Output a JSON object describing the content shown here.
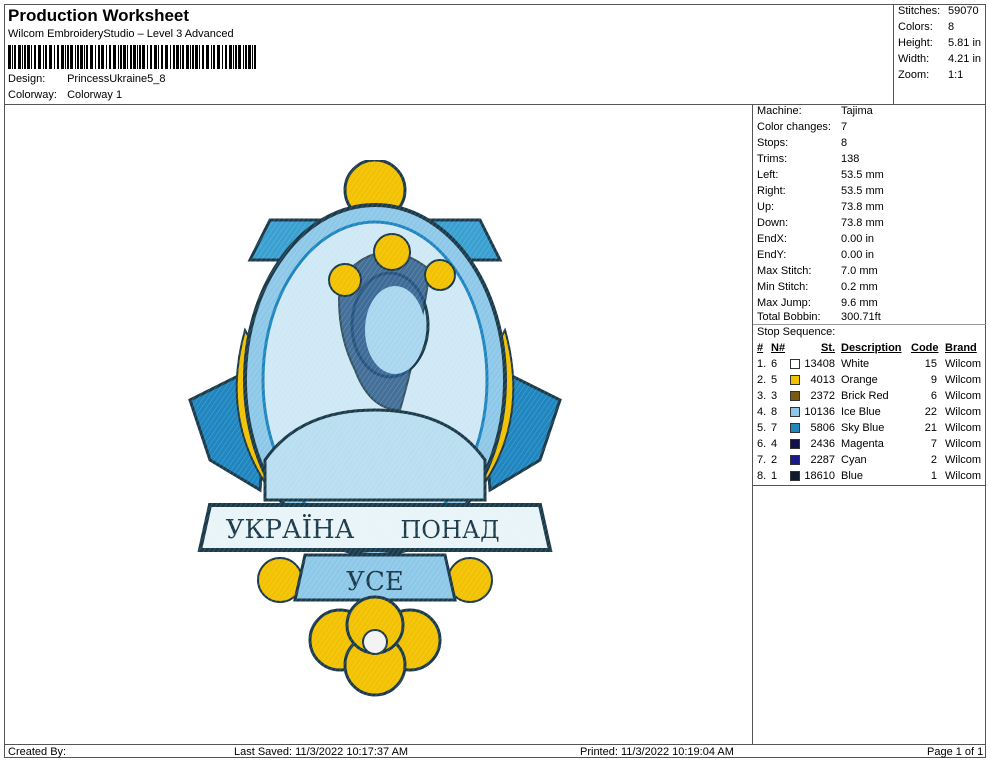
{
  "header": {
    "title": "Production Worksheet",
    "subtitle": "Wilcom EmbroideryStudio – Level 3 Advanced",
    "design_label": "Design:",
    "design_value": "PrincessUkraine5_8",
    "colorway_label": "Colorway:",
    "colorway_value": "Colorway 1"
  },
  "stats": [
    {
      "label": "Stitches:",
      "value": "59070"
    },
    {
      "label": "Colors:",
      "value": "8"
    },
    {
      "label": "Height:",
      "value": "5.81 in"
    },
    {
      "label": "Width:",
      "value": "4.21 in"
    },
    {
      "label": "Zoom:",
      "value": "1:1"
    }
  ],
  "machine_info": [
    {
      "label": "Machine:",
      "value": "Tajima"
    },
    {
      "label": "Color changes:",
      "value": "7"
    },
    {
      "label": "Stops:",
      "value": "8"
    },
    {
      "label": "Trims:",
      "value": "138"
    },
    {
      "label": "Left:",
      "value": "53.5 mm"
    },
    {
      "label": "Right:",
      "value": "53.5 mm"
    },
    {
      "label": "Up:",
      "value": "73.8 mm"
    },
    {
      "label": "Down:",
      "value": "73.8 mm"
    },
    {
      "label": "EndX:",
      "value": "0.00 in"
    },
    {
      "label": "EndY:",
      "value": "0.00 in"
    },
    {
      "label": "Max Stitch:",
      "value": "7.0 mm"
    },
    {
      "label": "Min Stitch:",
      "value": "0.2 mm"
    },
    {
      "label": "Max Jump:",
      "value": "9.6 mm"
    },
    {
      "label": "Total Bobbin:",
      "value": "300.71ft"
    }
  ],
  "stop_sequence": {
    "title": "Stop Sequence:",
    "headers": {
      "num": "#",
      "n": "N#",
      "st": "St.",
      "desc": "Description",
      "code": "Code",
      "brand": "Brand"
    },
    "rows": [
      {
        "idx": "1.",
        "n": "6",
        "st": "13408",
        "desc": "White",
        "code": "15",
        "brand": "Wilcom",
        "color": "#ffffff"
      },
      {
        "idx": "2.",
        "n": "5",
        "st": "4013",
        "desc": "Orange",
        "code": "9",
        "brand": "Wilcom",
        "color": "#f2c100"
      },
      {
        "idx": "3.",
        "n": "3",
        "st": "2372",
        "desc": "Brick Red",
        "code": "6",
        "brand": "Wilcom",
        "color": "#7a5a10"
      },
      {
        "idx": "4.",
        "n": "8",
        "st": "10136",
        "desc": "Ice Blue",
        "code": "22",
        "brand": "Wilcom",
        "color": "#8ec8e8"
      },
      {
        "idx": "5.",
        "n": "7",
        "st": "5806",
        "desc": "Sky Blue",
        "code": "21",
        "brand": "Wilcom",
        "color": "#1f86c0"
      },
      {
        "idx": "6.",
        "n": "4",
        "st": "2436",
        "desc": "Magenta",
        "code": "7",
        "brand": "Wilcom",
        "color": "#12104a"
      },
      {
        "idx": "7.",
        "n": "2",
        "st": "2287",
        "desc": "Cyan",
        "code": "2",
        "brand": "Wilcom",
        "color": "#1a1a8a"
      },
      {
        "idx": "8.",
        "n": "1",
        "st": "18610",
        "desc": "Blue",
        "code": "1",
        "brand": "Wilcom",
        "color": "#0f1a2e"
      }
    ]
  },
  "design_banner": {
    "text1": "УКРАЇНА",
    "text2": "ПОНАД",
    "text3": "УСЕ"
  },
  "footer": {
    "created_by": "Created By:",
    "last_saved": "Last Saved: 11/3/2022 10:17:37 AM",
    "printed": "Printed: 11/3/2022 10:19:04 AM",
    "page": "Page 1 of 1"
  }
}
